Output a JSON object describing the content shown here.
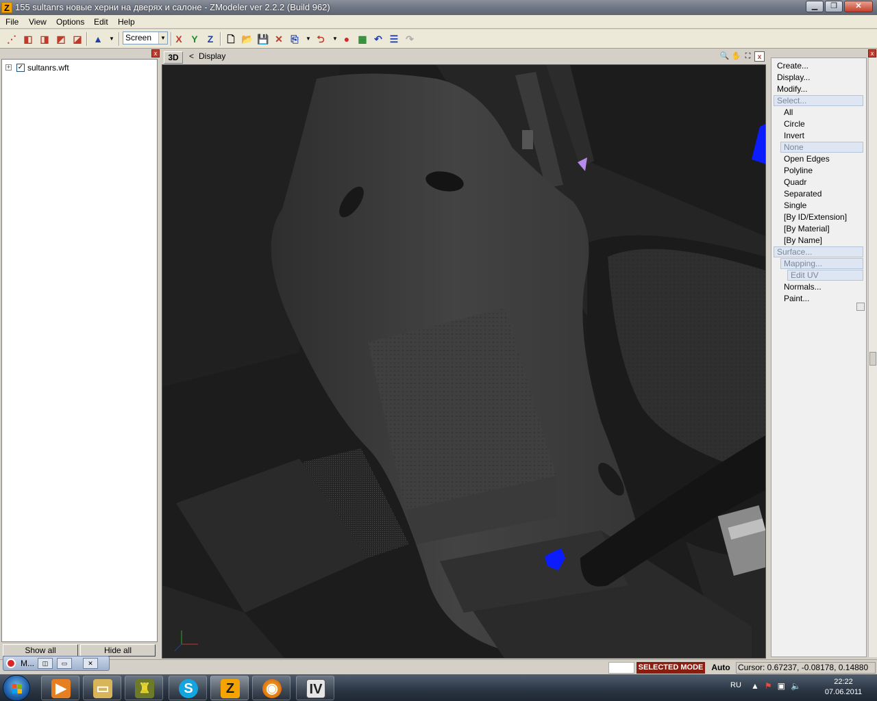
{
  "window": {
    "title": "155 sultanrs новые херни на дверях и салоне - ZModeler ver 2.2.2 (Build 962)",
    "app_icon_letter": "Z",
    "minimize": "▁",
    "restore": "❐",
    "close": "✕"
  },
  "menu": [
    "File",
    "View",
    "Options",
    "Edit",
    "Help"
  ],
  "toolbar": {
    "screen_select": "Screen",
    "axis_x": "X",
    "axis_y": "Y",
    "axis_z": "Z"
  },
  "left_panel": {
    "tree_item": "sultanrs.wft",
    "tree_checked": "✓",
    "expander": "+",
    "show_all": "Show all",
    "hide_all": "Hide all",
    "close": "x"
  },
  "viewport": {
    "tab": "3D",
    "crumb_arrow": "<",
    "crumb": "Display",
    "close": "x"
  },
  "right_panel": {
    "close": "x",
    "items": [
      {
        "label": "Create...",
        "indent": 0
      },
      {
        "label": "Display...",
        "indent": 0
      },
      {
        "label": "Modify...",
        "indent": 0
      },
      {
        "label": "Select...",
        "indent": 0,
        "highlight": true
      },
      {
        "label": "All",
        "indent": 1
      },
      {
        "label": "Circle",
        "indent": 1
      },
      {
        "label": "Invert",
        "indent": 1
      },
      {
        "label": "None",
        "indent": 1,
        "highlight": true
      },
      {
        "label": "Open Edges",
        "indent": 1
      },
      {
        "label": "Polyline",
        "indent": 1
      },
      {
        "label": "Quadr",
        "indent": 1
      },
      {
        "label": "Separated",
        "indent": 1
      },
      {
        "label": "Single",
        "indent": 1
      },
      {
        "label": "[By ID/Extension]",
        "indent": 1
      },
      {
        "label": "[By Material]",
        "indent": 1
      },
      {
        "label": "[By Name]",
        "indent": 1
      },
      {
        "label": "Surface...",
        "indent": 0,
        "highlight": true
      },
      {
        "label": "Mapping...",
        "indent": 1,
        "highlight": true
      },
      {
        "label": "Edit UV",
        "indent": 2,
        "highlight": true
      },
      {
        "label": "Normals...",
        "indent": 1
      },
      {
        "label": "Paint...",
        "indent": 1
      }
    ]
  },
  "mini_window": {
    "label": "M...",
    "btn1": "◫",
    "btn2": "▭",
    "btn3": "✕"
  },
  "status": {
    "mode": "SELECTED MODE",
    "auto": "Auto",
    "cursor": "Cursor: 0.67237, -0.08178, 0.14880"
  },
  "taskbar": {
    "lang": "RU",
    "time": "22:22",
    "date": "07.06.2011",
    "tasks": [
      "media",
      "explorer",
      "game",
      "skype",
      "zmodeler",
      "firefox",
      "openiv"
    ]
  }
}
